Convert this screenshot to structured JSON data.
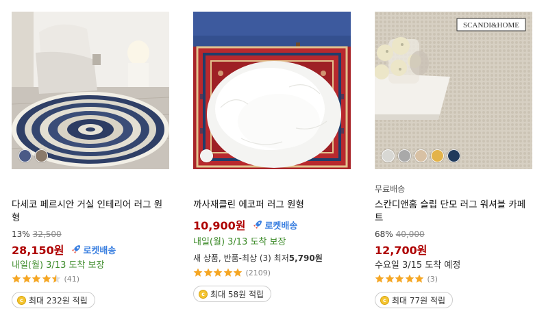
{
  "products": [
    {
      "title": "다세코 페르시안 거실 인테리어 러그 원형",
      "discount_rate": "13%",
      "original_price": "32,500",
      "price": "28,150원",
      "rocket_label": "로켓배송",
      "delivery": "내일(월) 3/13 도착 보장",
      "rating": 4.5,
      "review_count": "(41)",
      "reward": "최대 232원 적립",
      "swatch_colors": [
        "#4a5a86",
        "#8a7a6a"
      ]
    },
    {
      "title": "까사재클린 에코퍼 러그 원형",
      "price": "10,900원",
      "rocket_label": "로켓배송",
      "delivery": "내일(월) 3/13 도착 보장",
      "condition_prefix": "새 상품, 반품-최상 (3) 최저",
      "condition_price": "5,790원",
      "rating": 5,
      "review_count": "(2109)",
      "reward": "최대 58원 적립",
      "swatch_colors": [
        "#f2f2f2"
      ]
    },
    {
      "free_shipping": "무료배송",
      "title": "스칸디앤홈 슬립 단모 러그 워셔블 카페트",
      "discount_rate": "68%",
      "original_price": "40,000",
      "price": "12,700원",
      "delivery": "수요일 3/15 도착 예정",
      "rating": 5,
      "review_count": "(3)",
      "reward": "최대 77원 적립",
      "brand_label": "SCANDI&HOME",
      "swatch_colors": [
        "#d8d8d4",
        "#a9a9a9",
        "#d8c1a4",
        "#e3b34a",
        "#203a5c"
      ]
    }
  ],
  "colors": {
    "price": "#ae0000",
    "rocket": "#3a7fe0",
    "green": "#3d8b2a",
    "star": "#f5a623",
    "coin": "#f4c430"
  },
  "icons": {
    "rocket": "rocket-icon",
    "star": "star-icon",
    "coin": "coin-icon"
  }
}
